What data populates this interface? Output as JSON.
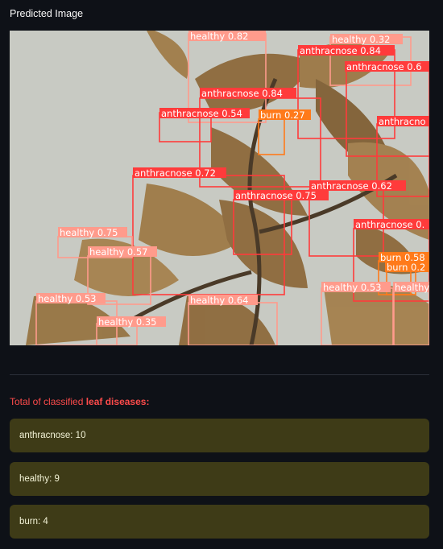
{
  "header": {
    "caption": "Predicted Image"
  },
  "detections": [
    {
      "label": "healthy 0.82",
      "color": "#ff9b8c"
    },
    {
      "label": "healthy 0.32",
      "color": "#ff9b8c"
    },
    {
      "label": "anthracnose 0.84",
      "color": "#ff3b3b"
    },
    {
      "label": "anthracnose 0.6",
      "color": "#ff3b3b"
    },
    {
      "label": "anthracnose 0.84",
      "color": "#ff3b3b"
    },
    {
      "label": "anthracnose 0.54",
      "color": "#ff3b3b"
    },
    {
      "label": "burn 0.27",
      "color": "#ff7a1a"
    },
    {
      "label": "anthracno",
      "color": "#ff3b3b"
    },
    {
      "label": "anthracnose 0.72",
      "color": "#ff3b3b"
    },
    {
      "label": "anthracnose 0.62",
      "color": "#ff3b3b"
    },
    {
      "label": "anthracnose 0.75",
      "color": "#ff3b3b"
    },
    {
      "label": "anthracnose 0.",
      "color": "#ff3b3b"
    },
    {
      "label": "healthy 0.75",
      "color": "#ff9b8c"
    },
    {
      "label": "healthy 0.57",
      "color": "#ff9b8c"
    },
    {
      "label": "burn 0.58",
      "color": "#ff7a1a"
    },
    {
      "label": "burn 0.2",
      "color": "#ff7a1a"
    },
    {
      "label": "healthy 0.53",
      "color": "#ff9b8c"
    },
    {
      "label": "healthy",
      "color": "#ff9b8c"
    },
    {
      "label": "healthy 0.53",
      "color": "#ff9b8c"
    },
    {
      "label": "healthy 0.64",
      "color": "#ff9b8c"
    },
    {
      "label": "healthy 0.35",
      "color": "#ff9b8c"
    }
  ],
  "summary": {
    "prefix": "Total of classified ",
    "emphasis": "leaf diseases:",
    "items": [
      {
        "label": "anthracnose: 10"
      },
      {
        "label": "healthy: 9"
      },
      {
        "label": "burn: 4"
      }
    ]
  },
  "colors": {
    "background": "#0e1117",
    "card": "#3e3b17",
    "accent_text": "#ff4b4b",
    "anthracnose": "#ff3b3b",
    "healthy": "#ff9b8c",
    "burn": "#ff7a1a"
  }
}
